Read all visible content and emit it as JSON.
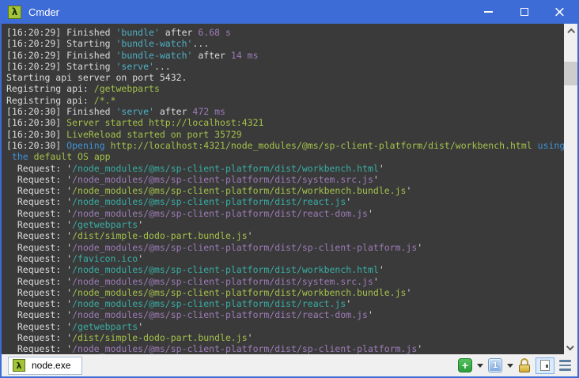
{
  "titlebar": {
    "title": "Cmder"
  },
  "icons": {
    "lambda": "λ",
    "plus": "+"
  },
  "colors": {
    "accent": "#3e6cd6",
    "terminal_bg": "#3a3a3a",
    "statusbar_bg": "#f0f0f0"
  },
  "terminal": {
    "palette": {
      "fg": "#dcdcdc",
      "cyan": "#4fb0c6",
      "teal": "#38ada3",
      "green": "#a4c14b",
      "purple": "#9d7bb7",
      "blue": "#4093d6"
    },
    "lines": [
      [
        {
          "t": "[16:20:29] Finished ",
          "c": "fg"
        },
        {
          "t": "'bundle'",
          "c": "cyan"
        },
        {
          "t": " after ",
          "c": "fg"
        },
        {
          "t": "6.68 s",
          "c": "purple"
        }
      ],
      [
        {
          "t": "[16:20:29] Starting ",
          "c": "fg"
        },
        {
          "t": "'bundle-watch'",
          "c": "cyan"
        },
        {
          "t": "...",
          "c": "fg"
        }
      ],
      [
        {
          "t": "[16:20:29] Finished ",
          "c": "fg"
        },
        {
          "t": "'bundle-watch'",
          "c": "cyan"
        },
        {
          "t": " after ",
          "c": "fg"
        },
        {
          "t": "14 ms",
          "c": "purple"
        }
      ],
      [
        {
          "t": "[16:20:29] Starting ",
          "c": "fg"
        },
        {
          "t": "'serve'",
          "c": "cyan"
        },
        {
          "t": "...",
          "c": "fg"
        }
      ],
      [
        {
          "t": "Starting api server on port 5432.",
          "c": "fg"
        }
      ],
      [
        {
          "t": "Registring api: ",
          "c": "fg"
        },
        {
          "t": "/getwebparts",
          "c": "green"
        }
      ],
      [
        {
          "t": "Registring api: ",
          "c": "fg"
        },
        {
          "t": "/*.*",
          "c": "green"
        }
      ],
      [
        {
          "t": "[16:20:30] Finished ",
          "c": "fg"
        },
        {
          "t": "'serve'",
          "c": "cyan"
        },
        {
          "t": " after ",
          "c": "fg"
        },
        {
          "t": "472 ms",
          "c": "purple"
        }
      ],
      [
        {
          "t": "[16:20:30] ",
          "c": "fg"
        },
        {
          "t": "Server started http://localhost:4321",
          "c": "green"
        }
      ],
      [
        {
          "t": "[16:20:30] ",
          "c": "fg"
        },
        {
          "t": "LiveReload started on port 35729",
          "c": "green"
        }
      ],
      [
        {
          "t": "[16:20:30] ",
          "c": "fg"
        },
        {
          "t": "Opening",
          "c": "blue"
        },
        {
          "t": " ",
          "c": "fg"
        },
        {
          "t": "http://localhost:4321/node_modules/@ms/sp-client-platform/dist/workbench.html",
          "c": "green"
        },
        {
          "t": " ",
          "c": "fg"
        },
        {
          "t": "using",
          "c": "blue"
        }
      ],
      [
        {
          "t": " ",
          "c": "fg"
        },
        {
          "t": "the",
          "c": "blue"
        },
        {
          "t": " ",
          "c": "fg"
        },
        {
          "t": "default OS app",
          "c": "green"
        }
      ],
      [
        {
          "t": "  Request: '",
          "c": "fg"
        },
        {
          "t": "/node_modules/@ms/sp-client-platform/dist/workbench.html",
          "c": "teal"
        },
        {
          "t": "'",
          "c": "fg"
        }
      ],
      [
        {
          "t": "  Request: '",
          "c": "fg"
        },
        {
          "t": "/node_modules/@ms/sp-client-platform/dist/system.src.js",
          "c": "purple"
        },
        {
          "t": "'",
          "c": "fg"
        }
      ],
      [
        {
          "t": "  Request: '",
          "c": "fg"
        },
        {
          "t": "/node_modules/@ms/sp-client-platform/dist/workbench.bundle.js",
          "c": "green"
        },
        {
          "t": "'",
          "c": "fg"
        }
      ],
      [
        {
          "t": "  Request: '",
          "c": "fg"
        },
        {
          "t": "/node_modules/@ms/sp-client-platform/dist/react.js",
          "c": "teal"
        },
        {
          "t": "'",
          "c": "fg"
        }
      ],
      [
        {
          "t": "  Request: '",
          "c": "fg"
        },
        {
          "t": "/node_modules/@ms/sp-client-platform/dist/react-dom.js",
          "c": "purple"
        },
        {
          "t": "'",
          "c": "fg"
        }
      ],
      [
        {
          "t": "  Request: '",
          "c": "fg"
        },
        {
          "t": "/getwebparts",
          "c": "teal"
        },
        {
          "t": "'",
          "c": "fg"
        }
      ],
      [
        {
          "t": "  Request: '",
          "c": "fg"
        },
        {
          "t": "/dist/simple-dodo-part.bundle.js",
          "c": "green"
        },
        {
          "t": "'",
          "c": "fg"
        }
      ],
      [
        {
          "t": "  Request: '",
          "c": "fg"
        },
        {
          "t": "/node_modules/@ms/sp-client-platform/dist/sp-client-platform.js",
          "c": "purple"
        },
        {
          "t": "'",
          "c": "fg"
        }
      ],
      [
        {
          "t": "  Request: '",
          "c": "fg"
        },
        {
          "t": "/favicon.ico",
          "c": "teal"
        },
        {
          "t": "'",
          "c": "fg"
        }
      ],
      [
        {
          "t": "  Request: '",
          "c": "fg"
        },
        {
          "t": "/node_modules/@ms/sp-client-platform/dist/workbench.html",
          "c": "teal"
        },
        {
          "t": "'",
          "c": "fg"
        }
      ],
      [
        {
          "t": "  Request: '",
          "c": "fg"
        },
        {
          "t": "/node_modules/@ms/sp-client-platform/dist/system.src.js",
          "c": "purple"
        },
        {
          "t": "'",
          "c": "fg"
        }
      ],
      [
        {
          "t": "  Request: '",
          "c": "fg"
        },
        {
          "t": "/node_modules/@ms/sp-client-platform/dist/workbench.bundle.js",
          "c": "green"
        },
        {
          "t": "'",
          "c": "fg"
        }
      ],
      [
        {
          "t": "  Request: '",
          "c": "fg"
        },
        {
          "t": "/node_modules/@ms/sp-client-platform/dist/react.js",
          "c": "teal"
        },
        {
          "t": "'",
          "c": "fg"
        }
      ],
      [
        {
          "t": "  Request: '",
          "c": "fg"
        },
        {
          "t": "/node_modules/@ms/sp-client-platform/dist/react-dom.js",
          "c": "purple"
        },
        {
          "t": "'",
          "c": "fg"
        }
      ],
      [
        {
          "t": "  Request: '",
          "c": "fg"
        },
        {
          "t": "/getwebparts",
          "c": "teal"
        },
        {
          "t": "'",
          "c": "fg"
        }
      ],
      [
        {
          "t": "  Request: '",
          "c": "fg"
        },
        {
          "t": "/dist/simple-dodo-part.bundle.js",
          "c": "green"
        },
        {
          "t": "'",
          "c": "fg"
        }
      ],
      [
        {
          "t": "  Request: '",
          "c": "fg"
        },
        {
          "t": "/node_modules/@ms/sp-client-platform/dist/sp-client-platform.js",
          "c": "purple"
        },
        {
          "t": "'",
          "c": "fg"
        }
      ]
    ]
  },
  "statusbar": {
    "tab_label": "node.exe",
    "console_count": "1"
  }
}
